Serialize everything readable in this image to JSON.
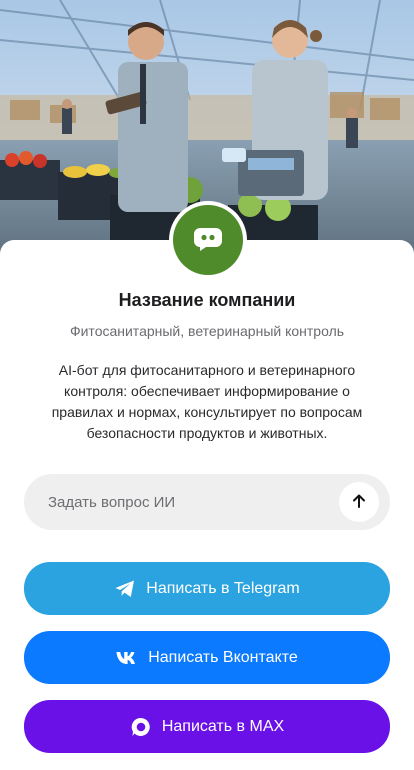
{
  "company": {
    "name": "Название компании",
    "category": "Фитосанитарный, ветеринарный контроль",
    "description": "AI-бот для фитосанитарного и ветеринарного контроля: обеспечивает информирование о правилах и нормах, консультирует по вопросам безопасности продуктов и животных."
  },
  "ask": {
    "placeholder": "Задать вопрос ИИ"
  },
  "buttons": {
    "telegram": "Написать в Telegram",
    "vk": "Написать Вконтакте",
    "max": "Написать в MAX"
  },
  "colors": {
    "avatar_bg": "#4f8a2b",
    "telegram": "#2aa3e0",
    "vk": "#0b7aff",
    "max": "#6a11e8",
    "input_bg": "#efefef"
  },
  "icons": {
    "avatar": "chat-bot-icon",
    "send": "arrow-up-icon",
    "telegram": "telegram-icon",
    "vk": "vk-icon",
    "max": "max-icon"
  }
}
